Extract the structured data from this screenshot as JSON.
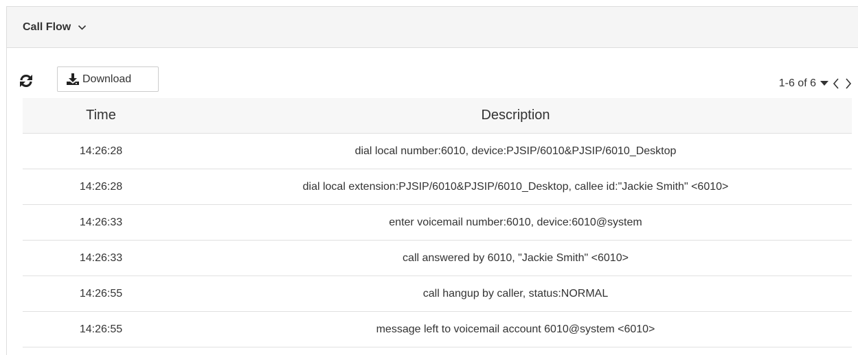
{
  "panel": {
    "title": "Call Flow",
    "title_icon": "chevron-down-icon"
  },
  "toolbar": {
    "refresh_icon": "refresh-icon",
    "download_icon": "download-icon",
    "download_label": "Download",
    "pagination_text": "1-6 of 6",
    "page_size_icon": "caret-down-icon",
    "prev_icon": "chevron-left-icon",
    "next_icon": "chevron-right-icon"
  },
  "table": {
    "headers": [
      "Time",
      "Description"
    ],
    "rows": [
      {
        "time": "14:26:28",
        "description": "dial local number:6010, device:PJSIP/6010&PJSIP/6010_Desktop"
      },
      {
        "time": "14:26:28",
        "description": "dial local extension:PJSIP/6010&PJSIP/6010_Desktop, callee id:\"Jackie Smith\" <6010>"
      },
      {
        "time": "14:26:33",
        "description": "enter voicemail number:6010, device:6010@system"
      },
      {
        "time": "14:26:33",
        "description": "call answered by 6010, \"Jackie Smith\" <6010>"
      },
      {
        "time": "14:26:55",
        "description": "call hangup by caller, status:NORMAL"
      },
      {
        "time": "14:26:55",
        "description": "message left to voicemail account 6010@system <6010>"
      }
    ]
  },
  "colors": {
    "header_bg": "#f5f5f5",
    "border": "#dddddd",
    "text": "#333333"
  }
}
